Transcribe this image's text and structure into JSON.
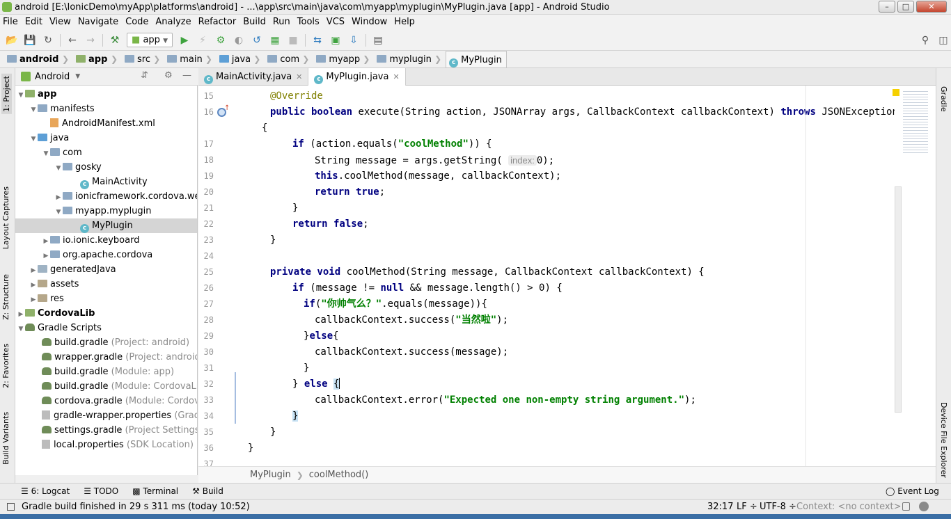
{
  "window": {
    "title": "android [E:\\IonicDemo\\myApp\\platforms\\android] - ...\\app\\src\\main\\java\\com\\myapp\\myplugin\\MyPlugin.java [app] - Android Studio",
    "min": "–",
    "max": "□",
    "close": "✕"
  },
  "menu": [
    "File",
    "Edit",
    "View",
    "Navigate",
    "Code",
    "Analyze",
    "Refactor",
    "Build",
    "Run",
    "Tools",
    "VCS",
    "Window",
    "Help"
  ],
  "toolbar": {
    "run_config": "app"
  },
  "breadcrumb": [
    "android",
    "app",
    "src",
    "main",
    "java",
    "com",
    "myapp",
    "myplugin",
    "MyPlugin"
  ],
  "project_panel": {
    "view_mode": "Android"
  },
  "left_strip": {
    "project": "1: Project",
    "captures": "Layout Captures",
    "structure": "Z: Structure",
    "favorites": "2: Favorites",
    "variants": "Build Variants"
  },
  "right_strip": {
    "gradle": "Gradle",
    "device": "Device File Explorer"
  },
  "tree": [
    {
      "label": "app",
      "hint": ""
    },
    {
      "label": "manifests",
      "hint": ""
    },
    {
      "label": "AndroidManifest.xml",
      "hint": ""
    },
    {
      "label": "java",
      "hint": ""
    },
    {
      "label": "com",
      "hint": ""
    },
    {
      "label": "gosky",
      "hint": ""
    },
    {
      "label": "MainActivity",
      "hint": ""
    },
    {
      "label": "ionicframework.cordova.web",
      "hint": ""
    },
    {
      "label": "myapp.myplugin",
      "hint": ""
    },
    {
      "label": "MyPlugin",
      "hint": ""
    },
    {
      "label": "io.ionic.keyboard",
      "hint": ""
    },
    {
      "label": "org.apache.cordova",
      "hint": ""
    },
    {
      "label": "generatedJava",
      "hint": ""
    },
    {
      "label": "assets",
      "hint": ""
    },
    {
      "label": "res",
      "hint": ""
    },
    {
      "label": "CordovaLib",
      "hint": ""
    },
    {
      "label": "Gradle Scripts",
      "hint": ""
    },
    {
      "label": "build.gradle",
      "hint": " (Project: android)"
    },
    {
      "label": "wrapper.gradle",
      "hint": " (Project: android)"
    },
    {
      "label": "build.gradle",
      "hint": " (Module: app)"
    },
    {
      "label": "build.gradle",
      "hint": " (Module: CordovaLib)"
    },
    {
      "label": "cordova.gradle",
      "hint": " (Module: CordovaL"
    },
    {
      "label": "gradle-wrapper.properties",
      "hint": " (Gradle"
    },
    {
      "label": "settings.gradle",
      "hint": " (Project Settings)"
    },
    {
      "label": "local.properties",
      "hint": " (SDK Location)"
    }
  ],
  "tabs": [
    {
      "label": "MainActivity.java",
      "active": false
    },
    {
      "label": "MyPlugin.java",
      "active": true
    }
  ],
  "code": {
    "line_numbers": [
      "15",
      "16",
      "",
      "17",
      "18",
      "19",
      "20",
      "21",
      "22",
      "23",
      "24",
      "25",
      "26",
      "27",
      "28",
      "29",
      "30",
      "31",
      "32",
      "33",
      "34",
      "35",
      "36",
      "37"
    ],
    "inlay_hint": "index:",
    "lines": [
      "@Override",
      "public boolean execute(String action, JSONArray args, CallbackContext callbackContext) throws JSONException",
      "{",
      "if (action.equals(\"coolMethod\")) {",
      "String message = args.getString( index: 0);",
      "this.coolMethod(message, callbackContext);",
      "return true;",
      "}",
      "return false;",
      "}",
      "",
      "private void coolMethod(String message, CallbackContext callbackContext) {",
      "if (message != null && message.length() > 0) {",
      "if(\"你帅气么？\".equals(message)){",
      "callbackContext.success(\"当然啦\");",
      "}else{",
      "callbackContext.success(message);",
      "}",
      "} else {",
      "callbackContext.error(\"Expected one non-empty string argument.\");",
      "}",
      "}",
      "}",
      ""
    ]
  },
  "editor_breadcrumb": [
    "MyPlugin",
    "coolMethod()"
  ],
  "tool_windows": [
    "6: Logcat",
    "TODO",
    "Terminal",
    "Build"
  ],
  "event_log": "Event Log",
  "status": {
    "message": "Gradle build finished in 29 s 311 ms (today 10:52)",
    "position": "32:17",
    "line_sep": "LF ÷",
    "encoding": "UTF-8 ÷",
    "context": "Context: <no context>"
  },
  "colors": {
    "keyword": "#000080",
    "string": "#008000",
    "annotation": "#808000",
    "current_line": "#fffae3"
  }
}
